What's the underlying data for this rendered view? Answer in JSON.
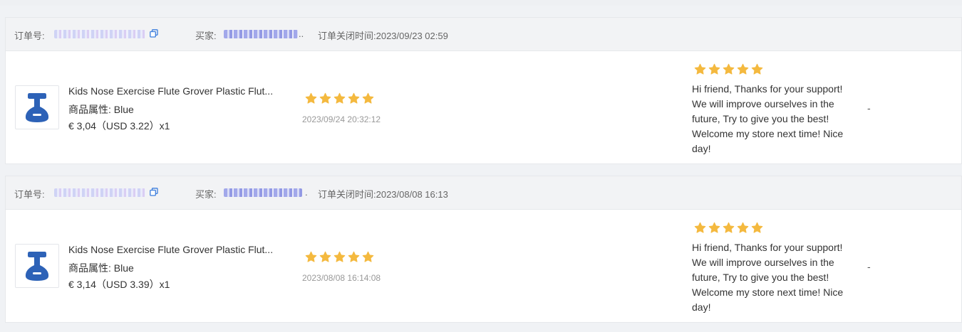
{
  "colors": {
    "star": "#f4b93f",
    "header_bg": "#f2f3f5",
    "copy_icon": "#3b7ddd"
  },
  "orders": [
    {
      "order_label": "订单号:",
      "buyer_label": "买家:",
      "buyer_suffix": "..",
      "close_time_label": "订单关闭时间:2023/09/23 02:59",
      "product": {
        "title": "Kids Nose Exercise Flute Grover Plastic Flut...",
        "attr": "商品属性:  Blue",
        "price": "€ 3,04（USD  3.22）x1"
      },
      "buyer_rating": 5,
      "eval_time": "2023/09/24 20:32:12",
      "seller_rating": 5,
      "reply": "Hi friend, Thanks for your support! We will improve ourselves in the future, Try to give you the best! Welcome my store next time! Nice day!",
      "action": "-"
    },
    {
      "order_label": "订单号:",
      "buyer_label": "买家:",
      "buyer_suffix": ".",
      "close_time_label": "订单关闭时间:2023/08/08 16:13",
      "product": {
        "title": "Kids Nose Exercise Flute Grover Plastic Flut...",
        "attr": "商品属性:  Blue",
        "price": "€ 3,14（USD  3.39）x1"
      },
      "buyer_rating": 5,
      "eval_time": "2023/08/08 16:14:08",
      "seller_rating": 5,
      "reply": "Hi friend, Thanks for your support! We will improve ourselves in the future, Try to give you the best! Welcome my store next time! Nice day!",
      "action": "-"
    }
  ]
}
